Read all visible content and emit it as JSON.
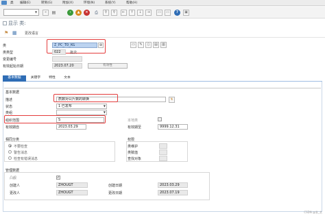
{
  "menu": {
    "items": [
      "类",
      "编辑(E)",
      "转到(G)",
      "附加(X)",
      "环境(N)",
      "系统(Y)",
      "帮助(H)"
    ]
  },
  "title": "显示 类:",
  "app_toolbar": {
    "label": "更改语言"
  },
  "header": {
    "class_label": "类",
    "class_value": "Z_PC_TO_KG",
    "class_type_label": "类类型",
    "class_type_value": "022",
    "class_type_text": "批次",
    "change_number_label": "变更编号",
    "valid_from_label": "有效起始日期",
    "valid_from_value": "2023.07.20",
    "validity_button": "有效性"
  },
  "tabs": [
    "基本数据",
    "关键字",
    "特性",
    "文本"
  ],
  "basic_data": {
    "group_title": "基本数据",
    "description_label": "描述",
    "description_value": "质数对公斤数的转换",
    "status_label": "状态",
    "status_value": "1 已发布",
    "class_group_label": "类组",
    "class_group_value": "",
    "org_area_label": "组织范围",
    "org_area_value": "S",
    "local_class_label": "本地类",
    "valid_from_label": "有效期自",
    "valid_from_value": "2023.03.29",
    "valid_to_label": "有效期至",
    "valid_to_value": "9999.12.31"
  },
  "same_classification": {
    "title": "相同分类",
    "options": [
      "不要检查",
      "警告消息",
      "检查有错误消息"
    ]
  },
  "authority": {
    "title": "权限",
    "rows": [
      "类维护",
      "类赋值",
      "查找对象"
    ]
  },
  "admin": {
    "title": "管理数据",
    "lock_label": "凸舰",
    "created_by_label": "创建人",
    "created_by_value": "ZHOUGT",
    "changed_by_label": "更改人",
    "changed_by_value": "ZHOUGT",
    "created_on_label": "创建日期",
    "created_on_value": "2023.03.29",
    "changed_on_label": "更改日期",
    "changed_on_value": "2023.07.19"
  },
  "watermark": "CSDN @发_艺"
}
